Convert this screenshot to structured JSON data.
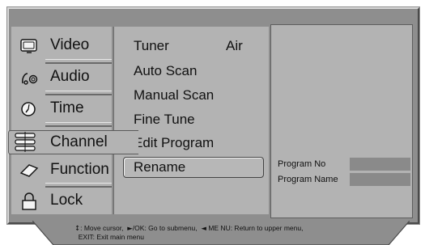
{
  "main_menu": {
    "items": [
      {
        "label": "Video",
        "icon": "tv-icon"
      },
      {
        "label": "Audio",
        "icon": "audio-icon"
      },
      {
        "label": "Time",
        "icon": "clock-icon"
      },
      {
        "label": "Channel",
        "icon": "channel-icon"
      },
      {
        "label": "Function",
        "icon": "function-icon"
      },
      {
        "label": "Lock",
        "icon": "lock-icon"
      }
    ],
    "selected": "Channel"
  },
  "submenu": {
    "items": [
      {
        "label": "Tuner",
        "value": "Air"
      },
      {
        "label": "Auto Scan"
      },
      {
        "label": "Manual Scan"
      },
      {
        "label": "Fine Tune"
      },
      {
        "label": "Edit Program"
      },
      {
        "label": "Rename"
      }
    ],
    "selected": "Rename"
  },
  "info": {
    "program_no_label": "Program No",
    "program_name_label": "Program Name",
    "program_no_value": "",
    "program_name_value": ""
  },
  "help": {
    "line1_move": ": Move cursor,",
    "line1_ok": "/OK: Go to submenu,",
    "line1_menu": "ME NU: Return to upper menu,",
    "line2": "EXIT: Exit main menu"
  },
  "colors": {
    "panel": "#8e8e8e",
    "menu_bg": "#b3b3b3",
    "field": "#8a8a8a"
  }
}
